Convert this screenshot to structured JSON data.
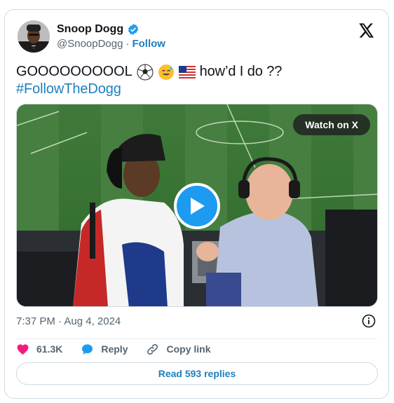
{
  "author": {
    "display_name": "Snoop Dogg",
    "handle": "@SnoopDogg",
    "separator": "·",
    "follow_label": "Follow",
    "verified": true
  },
  "tweet": {
    "text_main": "GOOOOOOOOOL",
    "text_after_emoji": "how’d I do ??",
    "emojis": [
      "soccer-ball-emoji",
      "sweat-smile-emoji",
      "us-flag-emoji"
    ],
    "hashtag": "#FollowTheDogg"
  },
  "media": {
    "watch_label": "Watch on X"
  },
  "meta": {
    "timestamp": "7:37 PM · Aug 4, 2024"
  },
  "actions": {
    "likes": "61.3K",
    "reply_label": "Reply",
    "copy_link_label": "Copy link"
  },
  "replies_button": "Read 593 replies",
  "colors": {
    "link_blue": "#1d7fbf",
    "like_pink": "#f91880",
    "play_blue": "#1d9bf0",
    "muted_text": "#536471"
  }
}
